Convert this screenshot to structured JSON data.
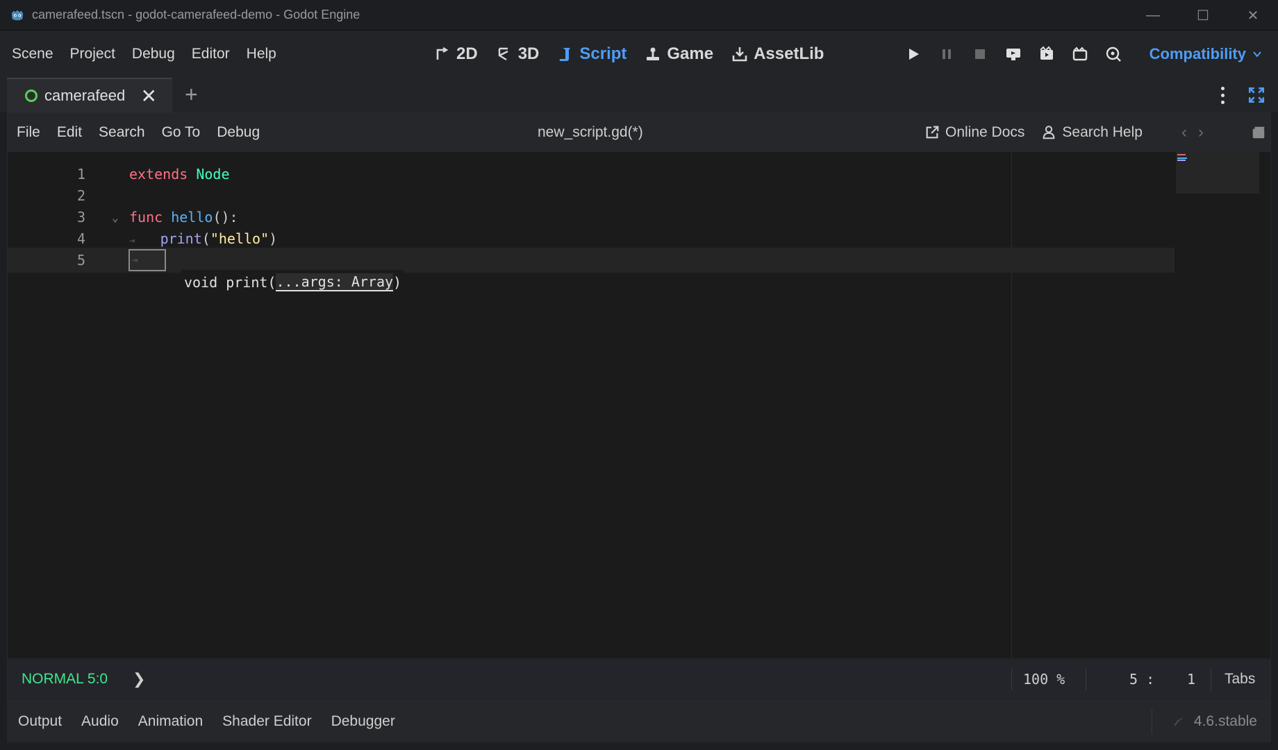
{
  "window": {
    "title": "camerafeed.tscn - godot-camerafeed-demo - Godot Engine",
    "controls": {
      "minimize": "—",
      "maximize": "☐",
      "close": "✕"
    }
  },
  "main_menu": [
    "Scene",
    "Project",
    "Debug",
    "Editor",
    "Help"
  ],
  "workspaces": [
    {
      "label": "2D",
      "icon": "2d-icon",
      "active": false
    },
    {
      "label": "3D",
      "icon": "3d-icon",
      "active": false
    },
    {
      "label": "Script",
      "icon": "script-icon",
      "active": true
    },
    {
      "label": "Game",
      "icon": "game-icon",
      "active": false
    },
    {
      "label": "AssetLib",
      "icon": "assetlib-icon",
      "active": false
    }
  ],
  "play_controls": [
    "play-icon",
    "pause-icon",
    "stop-icon",
    "remote-debug-icon",
    "run-current-scene-icon",
    "run-custom-scene-icon",
    "movie-maker-icon"
  ],
  "renderer": {
    "label": "Compatibility"
  },
  "scene_tabs": [
    {
      "name": "camerafeed",
      "close": "✕"
    }
  ],
  "add_tab": "+",
  "script_menu": [
    "File",
    "Edit",
    "Search",
    "Go To",
    "Debug"
  ],
  "script_title": "new_script.gd(*)",
  "help_buttons": [
    {
      "label": "Online Docs",
      "icon": "external-link-icon"
    },
    {
      "label": "Search Help",
      "icon": "search-help-icon"
    }
  ],
  "nav": {
    "back": "‹",
    "forward": "›"
  },
  "code": {
    "line_numbers": [
      "1",
      "2",
      "3",
      "4",
      "5"
    ],
    "fold_marker": "⌄",
    "tab_marker": "⇥",
    "line1": {
      "kw": "extends",
      "cls": "Node"
    },
    "line3": {
      "kw": "func",
      "fn": "hello",
      "punct": "():"
    },
    "line4": {
      "bi": "print",
      "open": "(",
      "str": "\"hello\"",
      "close": ")"
    },
    "hint": {
      "prefix": "void print(",
      "arg": "...args: Array",
      "suffix": ")"
    }
  },
  "status": {
    "vim_mode": "NORMAL 5:0",
    "chevron": "❯",
    "zoom": "100 %",
    "line": "5 :",
    "column": "1",
    "indent": "Tabs"
  },
  "bottom_tabs": [
    "Output",
    "Audio",
    "Animation",
    "Shader Editor",
    "Debugger"
  ],
  "version": "4.6.stable",
  "colors": {
    "accent": "#4f9df6",
    "keyword": "#ff7085",
    "class": "#42ffc2",
    "function": "#57b3ff",
    "string": "#ffeda1",
    "vim_mode": "#42e68a"
  }
}
